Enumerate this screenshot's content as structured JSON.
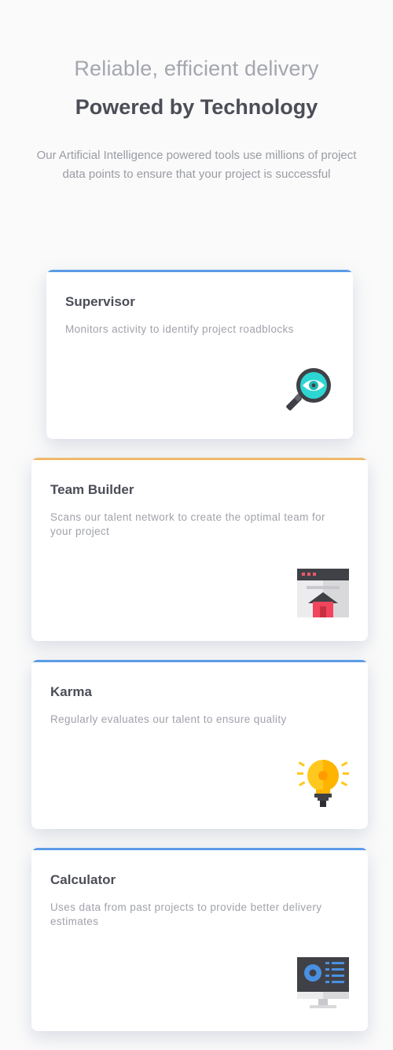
{
  "hero": {
    "subtitle": "Reliable, efficient delivery",
    "title": "Powered by Technology",
    "description": "Our Artificial Intelligence powered tools use millions of project data points to ensure that your project is successful"
  },
  "colors": {
    "blue_accent": "#5b9ce6",
    "orange_accent": "#f0b86a"
  },
  "cards": [
    {
      "title": "Supervisor",
      "description": "Monitors activity to identify project roadblocks",
      "icon": "magnifier-eye-icon",
      "accent": "blue"
    },
    {
      "title": "Team Builder",
      "description": "Scans our talent network to create the optimal team for your project",
      "icon": "browser-house-icon",
      "accent": "orange"
    },
    {
      "title": "Karma",
      "description": "Regularly evaluates our talent to ensure quality",
      "icon": "lightbulb-icon",
      "accent": "blue"
    },
    {
      "title": "Calculator",
      "description": "Uses data from past projects to provide better delivery estimates",
      "icon": "monitor-chart-icon",
      "accent": "blue"
    }
  ]
}
